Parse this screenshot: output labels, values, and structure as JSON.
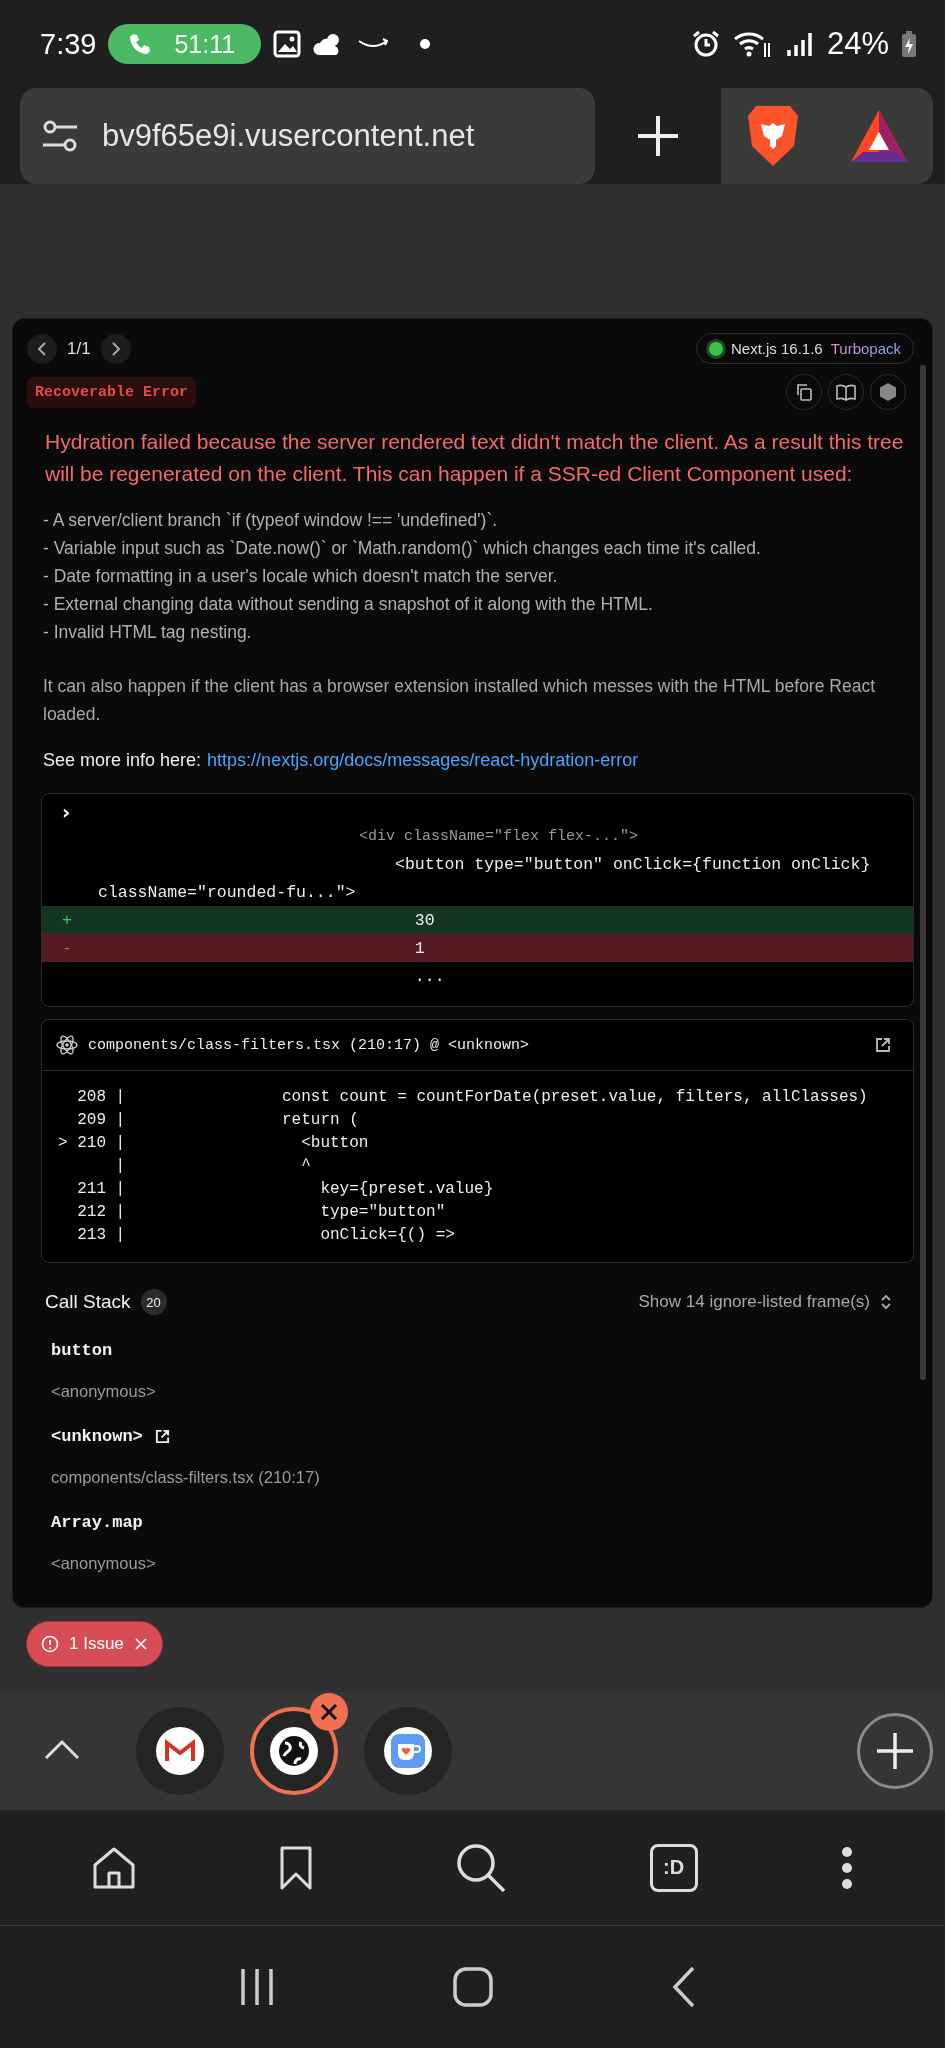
{
  "status_bar": {
    "time": "7:39",
    "call_timer": "51:11",
    "battery": "24%"
  },
  "browser": {
    "url": "bv9f65e9i.vusercontent.net"
  },
  "error_overlay": {
    "pager": "1/1",
    "version": "Next.js 16.1.6",
    "bundler": "Turbopack",
    "label": "Recoverable Error",
    "title": "Hydration failed because the server rendered text didn't match the client. As a result this tree will be regenerated on the client. This can happen if a SSR-ed Client Component used:",
    "bullets": [
      "- A server/client branch `if (typeof window !== 'undefined')`.",
      "- Variable input such as `Date.now()` or `Math.random()` which changes each time it's called.",
      "- Date formatting in a user's locale which doesn't match the server.",
      "- External changing data without sending a snapshot of it along with the HTML.",
      "- Invalid HTML tag nesting."
    ],
    "paragraph": "It can also happen if the client has a browser extension installed which messes with the HTML before React loaded.",
    "see_more": {
      "label": "See more info here:",
      "link": "https://nextjs.org/docs/messages/react-hydration-error"
    },
    "diff": {
      "toggle": "›",
      "lines": [
        {
          "kind": "faded",
          "text": "                             <div className=\"flex flex-...\">"
        },
        {
          "kind": "context",
          "text": "                              <button type=\"button\" onClick={function onClick}"
        },
        {
          "kind": "context",
          "text": "className=\"rounded-fu...\">"
        },
        {
          "kind": "added",
          "sign": "+",
          "text": "                                30"
        },
        {
          "kind": "removed",
          "sign": "-",
          "text": "                                1"
        },
        {
          "kind": "context",
          "text": "                                ..."
        }
      ]
    },
    "code_frame": {
      "file": "components/class-filters.tsx (210:17) @ <unknown>",
      "lines": [
        {
          "gutter": "  208 |",
          "text": "const count = countForDate(preset.value, filters, allClasses)"
        },
        {
          "gutter": "  209 |",
          "text": "return ("
        },
        {
          "gutter": "> 210 |",
          "text": "  <button"
        },
        {
          "gutter": "      |",
          "text": "  ^"
        },
        {
          "gutter": "  211 |",
          "text": "    key={preset.value}"
        },
        {
          "gutter": "  212 |",
          "text": "    type=\"button\""
        },
        {
          "gutter": "  213 |",
          "text": "    onClick={() =>"
        }
      ]
    },
    "call_stack": {
      "title": "Call Stack",
      "count": "20",
      "toggle": "Show 14 ignore-listed frame(s)",
      "frames": [
        {
          "name": "button",
          "location": "<anonymous>",
          "external": false
        },
        {
          "name": "<unknown>",
          "location": "components/class-filters.tsx (210:17)",
          "external": true
        },
        {
          "name": "Array.map",
          "location": "<anonymous>",
          "external": false
        }
      ]
    }
  },
  "issue_badge": "1 Issue",
  "tabs": [
    {
      "kind": "mail",
      "selected": false
    },
    {
      "kind": "globe",
      "selected": true
    },
    {
      "kind": "coffee",
      "selected": false
    }
  ],
  "bottom_nav": {
    "tabs_label": ":D"
  }
}
